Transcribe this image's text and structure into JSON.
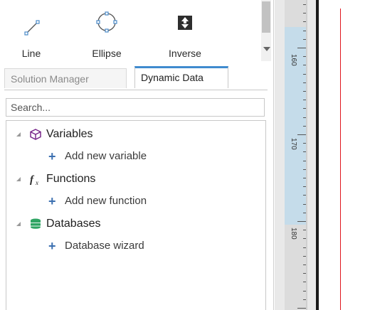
{
  "toolbar": {
    "tools": [
      {
        "label": "Line",
        "icon": "line-icon"
      },
      {
        "label": "Ellipse",
        "icon": "ellipse-icon"
      },
      {
        "label": "Inverse",
        "icon": "inverse-icon"
      }
    ]
  },
  "tabs": [
    {
      "label": "Solution Manager",
      "active": false
    },
    {
      "label": "Dynamic Data",
      "active": true
    }
  ],
  "search": {
    "placeholder": "Search...",
    "value": ""
  },
  "tree": [
    {
      "label": "Variables",
      "icon": "variables-icon",
      "child": "Add new variable"
    },
    {
      "label": "Functions",
      "icon": "function-icon",
      "child": "Add new function"
    },
    {
      "label": "Databases",
      "icon": "database-icon",
      "child": "Database wizard"
    }
  ],
  "ruler": {
    "labels": [
      "160",
      "170",
      "180"
    ]
  },
  "colors": {
    "accent": "#3f8bcf",
    "ruler_highlight": "#c5dcea",
    "guide_line": "#e0161f",
    "plus": "#3b6fb0"
  }
}
